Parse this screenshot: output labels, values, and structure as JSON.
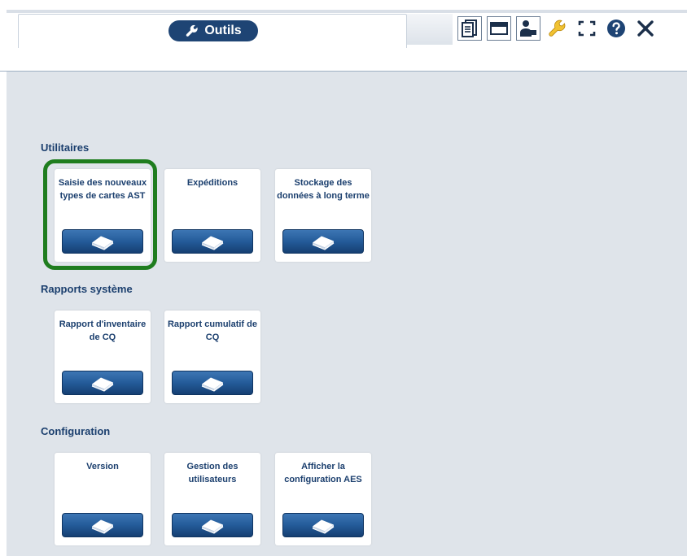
{
  "header": {
    "tab_title": "Outils",
    "tab_icon": "wrench-icon",
    "toolbar": [
      {
        "name": "report-icon",
        "boxed": true
      },
      {
        "name": "drawer-icon",
        "boxed": true
      },
      {
        "name": "user-icon",
        "boxed": true
      },
      {
        "name": "wrench-icon",
        "boxed": false
      },
      {
        "name": "fullscreen-icon",
        "boxed": false
      },
      {
        "name": "help-icon",
        "boxed": false
      },
      {
        "name": "close-icon",
        "boxed": false
      }
    ]
  },
  "sections": [
    {
      "title": "Utilitaires",
      "cards": [
        {
          "label": "Saisie des nouveaux types de cartes AST",
          "highlighted": true
        },
        {
          "label": "Expéditions"
        },
        {
          "label": "Stockage des données à long terme"
        }
      ]
    },
    {
      "title": "Rapports système",
      "cards": [
        {
          "label": "Rapport d'inventaire de CQ"
        },
        {
          "label": "Rapport cumulatif de CQ"
        }
      ]
    },
    {
      "title": "Configuration",
      "cards": [
        {
          "label": "Version"
        },
        {
          "label": "Gestion des utilisateurs"
        },
        {
          "label": "Afficher la configuration AES"
        }
      ]
    }
  ],
  "colors": {
    "navy": "#1e4474",
    "highlight": "#1f7d1f",
    "background": "#dfe4ea"
  }
}
